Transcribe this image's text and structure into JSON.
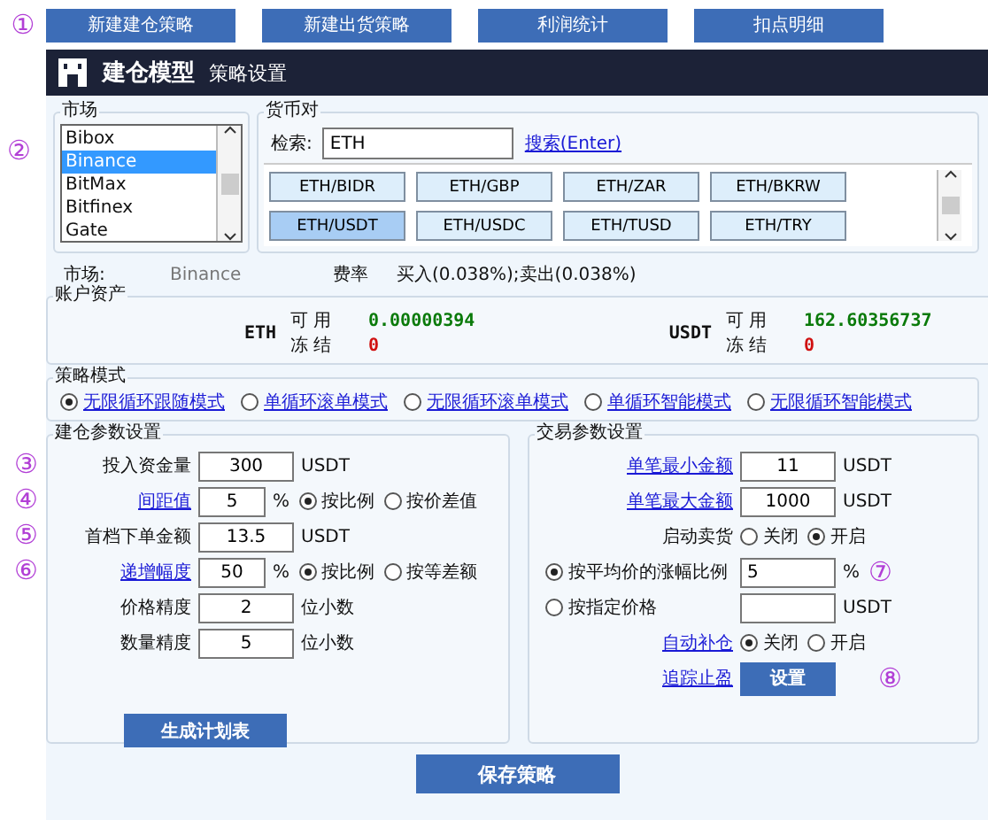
{
  "top_bar": {
    "marker": "①",
    "buttons": [
      "新建建仓策略",
      "新建出货策略",
      "利润统计",
      "扣点明细"
    ]
  },
  "header": {
    "title": "建仓模型",
    "subtitle": "策略设置"
  },
  "market": {
    "marker": "②",
    "legend": "市场",
    "items": [
      {
        "label": "Bibox",
        "selected": false
      },
      {
        "label": "Binance",
        "selected": true
      },
      {
        "label": "BitMax",
        "selected": false
      },
      {
        "label": "Bitfinex",
        "selected": false
      },
      {
        "label": "Gate",
        "selected": false
      }
    ]
  },
  "pairs": {
    "legend": "货币对",
    "search_label": "检索:",
    "search_value": "ETH",
    "search_link": "搜索(Enter)",
    "items": [
      {
        "label": "ETH/BIDR",
        "selected": false
      },
      {
        "label": "ETH/GBP",
        "selected": false
      },
      {
        "label": "ETH/ZAR",
        "selected": false
      },
      {
        "label": "ETH/BKRW",
        "selected": false
      },
      {
        "label": "ETH/USDT",
        "selected": true
      },
      {
        "label": "ETH/USDC",
        "selected": false
      },
      {
        "label": "ETH/TUSD",
        "selected": false
      },
      {
        "label": "ETH/TRY",
        "selected": false
      }
    ]
  },
  "info": {
    "market_label": "市场:",
    "market_value": "Binance",
    "fee_label": "费率",
    "fee_value": "买入(0.038%);卖出(0.038%)"
  },
  "assets": {
    "legend": "账户资产",
    "coins": [
      {
        "name": "ETH",
        "available_label": "可 用",
        "available": "0.00000394",
        "frozen_label": "冻 结",
        "frozen": "0"
      },
      {
        "name": "USDT",
        "available_label": "可 用",
        "available": "162.60356737",
        "frozen_label": "冻 结",
        "frozen": "0"
      }
    ]
  },
  "modes": {
    "legend": "策略模式",
    "items": [
      {
        "label": "无限循环跟随模式",
        "selected": true
      },
      {
        "label": "单循环滚单模式",
        "selected": false
      },
      {
        "label": "无限循环滚单模式",
        "selected": false
      },
      {
        "label": "单循环智能模式",
        "selected": false
      },
      {
        "label": "无限循环智能模式",
        "selected": false
      }
    ]
  },
  "build_params": {
    "legend": "建仓参数设置",
    "button": "生成计划表",
    "rows": [
      {
        "kind": "input",
        "marker": "③",
        "label": "投入资金量",
        "link": false,
        "value": "300",
        "unit": "USDT"
      },
      {
        "kind": "ratio",
        "marker": "④",
        "label": "间距值",
        "link": true,
        "value": "5",
        "unit": "%",
        "options": [
          {
            "label": "按比例",
            "selected": true
          },
          {
            "label": "按价差值",
            "selected": false
          }
        ]
      },
      {
        "kind": "input",
        "marker": "⑤",
        "label": "首档下单金额",
        "link": false,
        "value": "13.5",
        "unit": "USDT"
      },
      {
        "kind": "ratio",
        "marker": "⑥",
        "label": "递增幅度",
        "link": true,
        "value": "50",
        "unit": "%",
        "options": [
          {
            "label": "按比例",
            "selected": true
          },
          {
            "label": "按等差额",
            "selected": false
          }
        ]
      },
      {
        "kind": "input",
        "label": "价格精度",
        "link": false,
        "value": "2",
        "unit": "位小数"
      },
      {
        "kind": "input",
        "label": "数量精度",
        "link": false,
        "value": "5",
        "unit": "位小数"
      }
    ]
  },
  "trade_params": {
    "legend": "交易参数设置",
    "rows": [
      {
        "kind": "input",
        "label": "单笔最小金额",
        "link": true,
        "value": "11",
        "unit": "USDT"
      },
      {
        "kind": "input",
        "label": "单笔最大金额",
        "link": true,
        "value": "1000",
        "unit": "USDT"
      },
      {
        "kind": "toggle",
        "label": "启动卖货",
        "link": false,
        "options": [
          {
            "label": "关闭",
            "selected": false
          },
          {
            "label": "开启",
            "selected": true
          }
        ]
      },
      {
        "kind": "choice",
        "label": "按平均价的涨幅比例",
        "selected": true,
        "value": "5",
        "unit": "%",
        "marker": "⑦"
      },
      {
        "kind": "choice",
        "label": "按指定价格",
        "selected": false,
        "unit": "USDT"
      },
      {
        "kind": "toggle",
        "label": "自动补仓",
        "link": true,
        "options": [
          {
            "label": "关闭",
            "selected": true
          },
          {
            "label": "开启",
            "selected": false
          }
        ]
      },
      {
        "kind": "button",
        "label": "追踪止盈",
        "link": true,
        "button": "设置",
        "marker": "⑧"
      }
    ]
  },
  "save_button": "保存策略"
}
